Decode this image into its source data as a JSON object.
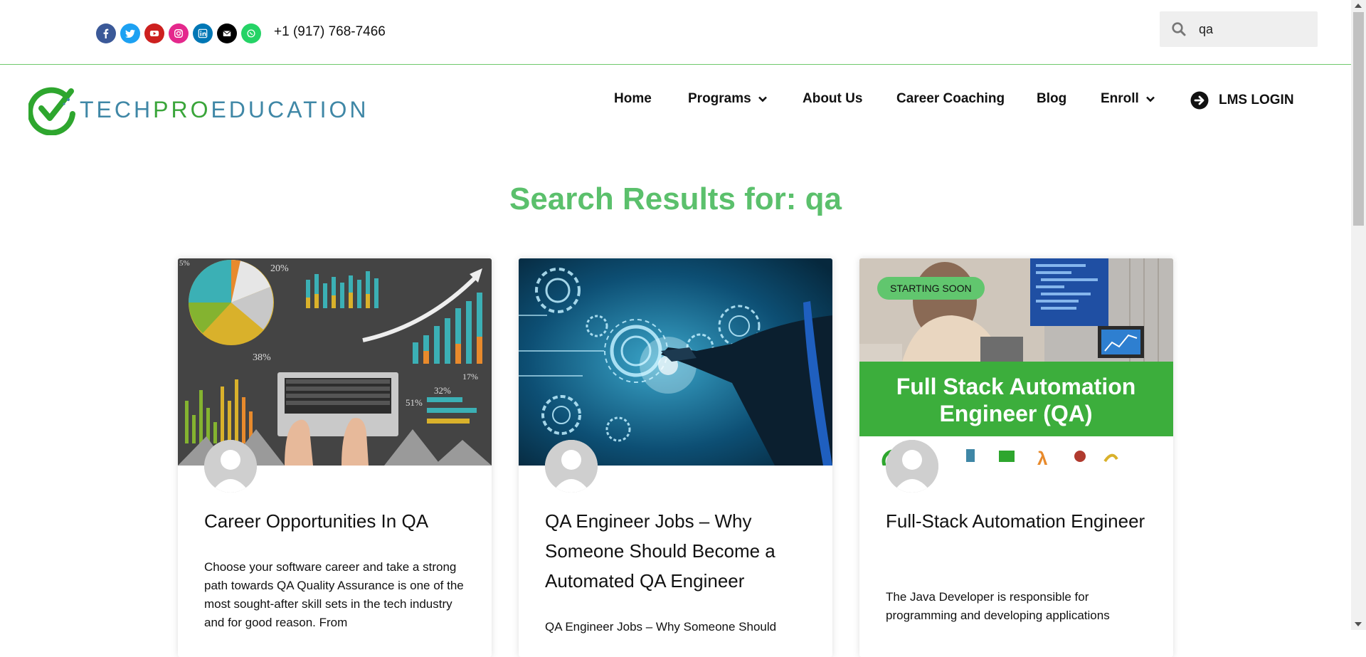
{
  "header": {
    "social_icons": [
      {
        "name": "facebook-icon",
        "color": "#3b5998"
      },
      {
        "name": "twitter-icon",
        "color": "#1da1f2"
      },
      {
        "name": "youtube-icon",
        "color": "#cd201f"
      },
      {
        "name": "instagram-icon",
        "color": "#e4288c"
      },
      {
        "name": "linkedin-icon",
        "color": "#0077b5"
      },
      {
        "name": "envelope-icon",
        "color": "#000000"
      },
      {
        "name": "whatsapp-icon",
        "color": "#25d366"
      }
    ],
    "phone": "+1 (917) 768-7466",
    "search": {
      "value": "qa"
    }
  },
  "logo": {
    "part1": "TECH",
    "part2": "PRO",
    "part3": "EDUCATION"
  },
  "nav": {
    "home": "Home",
    "programs": "Programs",
    "about": "About Us",
    "career": "Career Coaching",
    "blog": "Blog",
    "enroll": "Enroll",
    "lms": "LMS LOGIN"
  },
  "page": {
    "heading": "Search Results for: qa"
  },
  "cards": [
    {
      "title": "Career Opportunities In QA",
      "excerpt": "Choose your software career and take a strong path towards QA Quality Assurance is one of the most sought-after skill sets in the tech industry and for good reason. From"
    },
    {
      "title": "QA Engineer Jobs – Why Someone Should Become a Automated QA Engineer",
      "excerpt": "QA Engineer Jobs – Why Someone Should"
    },
    {
      "title": "Full-Stack Automation Engineer",
      "badge": "STARTING SOON",
      "image_text": "Full Stack Automation Engineer (QA)",
      "image_text_line1": "Full Stack Automation",
      "image_text_line2": "Engineer (QA)",
      "excerpt": "The Java Developer is responsible for programming and developing applications"
    }
  ],
  "colors": {
    "accent": "#5bc06c",
    "brand_blue": "#3f87a6",
    "brand_green": "#3aa53a"
  },
  "chart_image_labels": [
    "20%",
    "38%",
    "51%",
    "32%",
    "17%",
    "5%"
  ]
}
